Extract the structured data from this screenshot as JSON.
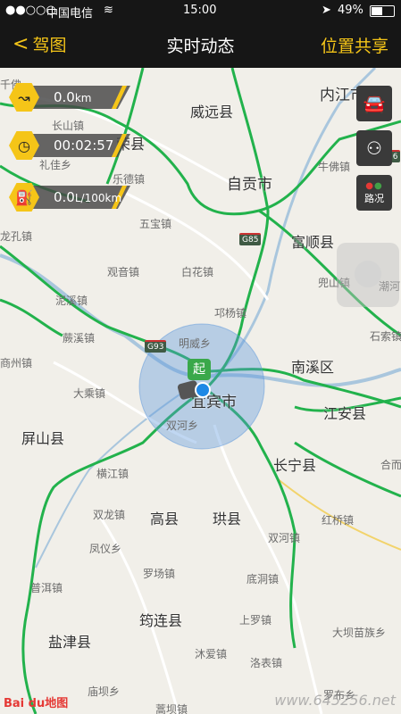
{
  "status_bar": {
    "carrier": "中国电信",
    "time": "15:00",
    "battery": "49%"
  },
  "nav": {
    "back_label": "驾图",
    "title": "实时动态",
    "right_label": "位置共享"
  },
  "stats": {
    "distance": "0.0",
    "distance_unit": "km",
    "duration": "00:02:57",
    "fuel": "0.0",
    "fuel_unit": "L/100km"
  },
  "side_buttons": {
    "traffic_label": "路况"
  },
  "start_marker": "起",
  "highways": [
    "G85",
    "G93",
    "G76"
  ],
  "places": [
    {
      "id": "weiyuan",
      "name": "威远县",
      "type": "county"
    },
    {
      "id": "neijiang",
      "name": "内江市",
      "type": "city"
    },
    {
      "id": "zigong",
      "name": "自贡市",
      "type": "city"
    },
    {
      "id": "rong",
      "name": "荣县",
      "type": "county"
    },
    {
      "id": "fushun",
      "name": "富顺县",
      "type": "county"
    },
    {
      "id": "yibin",
      "name": "宜宾市",
      "type": "city"
    },
    {
      "id": "nanxi",
      "name": "南溪区",
      "type": "county"
    },
    {
      "id": "jiangan",
      "name": "江安县",
      "type": "county"
    },
    {
      "id": "pingshan",
      "name": "屏山县",
      "type": "county"
    },
    {
      "id": "changning",
      "name": "长宁县",
      "type": "county"
    },
    {
      "id": "gao",
      "name": "高县",
      "type": "county"
    },
    {
      "id": "gong",
      "name": "珙县",
      "type": "county"
    },
    {
      "id": "junlian",
      "name": "筠连县",
      "type": "county"
    },
    {
      "id": "yanjin",
      "name": "盐津县",
      "type": "county"
    },
    {
      "id": "niufo",
      "name": "牛佛镇",
      "type": "town"
    },
    {
      "id": "leshan",
      "name": "乐德镇",
      "type": "town"
    },
    {
      "id": "wubao",
      "name": "五宝镇",
      "type": "town"
    },
    {
      "id": "baihua",
      "name": "白花镇",
      "type": "town"
    },
    {
      "id": "guanyin",
      "name": "观音镇",
      "type": "town"
    },
    {
      "id": "doushan",
      "name": "兜山镇",
      "type": "town"
    },
    {
      "id": "qiong",
      "name": "邛杨镇",
      "type": "town"
    },
    {
      "id": "mingwei",
      "name": "明威乡",
      "type": "town"
    },
    {
      "id": "shiqiao",
      "name": "石索镇",
      "type": "town"
    },
    {
      "id": "dacheng",
      "name": "大乘镇",
      "type": "town"
    },
    {
      "id": "shangzhou",
      "name": "商州镇",
      "type": "town"
    },
    {
      "id": "jixi",
      "name": "蕨溪镇",
      "type": "town"
    },
    {
      "id": "nixi",
      "name": "泥溪镇",
      "type": "town"
    },
    {
      "id": "shuanghe1",
      "name": "双河乡",
      "type": "town"
    },
    {
      "id": "hengjiang",
      "name": "横江镇",
      "type": "town"
    },
    {
      "id": "shuanglong",
      "name": "双龙镇",
      "type": "town"
    },
    {
      "id": "fengyi",
      "name": "凤仪乡",
      "type": "town"
    },
    {
      "id": "luochang",
      "name": "罗场镇",
      "type": "town"
    },
    {
      "id": "shuanghe2",
      "name": "双河镇",
      "type": "town"
    },
    {
      "id": "hongqiao",
      "name": "红桥镇",
      "type": "town"
    },
    {
      "id": "didong",
      "name": "底洞镇",
      "type": "town"
    },
    {
      "id": "shangluo",
      "name": "上罗镇",
      "type": "town"
    },
    {
      "id": "muai",
      "name": "沐爱镇",
      "type": "town"
    },
    {
      "id": "luobiao",
      "name": "洛表镇",
      "type": "town"
    },
    {
      "id": "pujiang",
      "name": "普洱镇",
      "type": "town"
    },
    {
      "id": "miaoba",
      "name": "庙坝乡",
      "type": "town"
    },
    {
      "id": "dayuanmiao",
      "name": "大坝苗族乡",
      "type": "town"
    },
    {
      "id": "heyue",
      "name": "合而",
      "type": "town"
    },
    {
      "id": "chaoxi",
      "name": "潮河",
      "type": "town"
    },
    {
      "id": "longze",
      "name": "龙孔镇",
      "type": "town"
    },
    {
      "id": "lijia",
      "name": "礼佳乡",
      "type": "town"
    },
    {
      "id": "changshan",
      "name": "长山镇",
      "type": "town"
    },
    {
      "id": "qianfo",
      "name": "千佛",
      "type": "town"
    },
    {
      "id": "luobo",
      "name": "罗布乡",
      "type": "town"
    },
    {
      "id": "jiluo",
      "name": "蒿坝镇",
      "type": "town"
    }
  ],
  "map_logo": "Bai du地图",
  "watermark": "www.645256.net"
}
